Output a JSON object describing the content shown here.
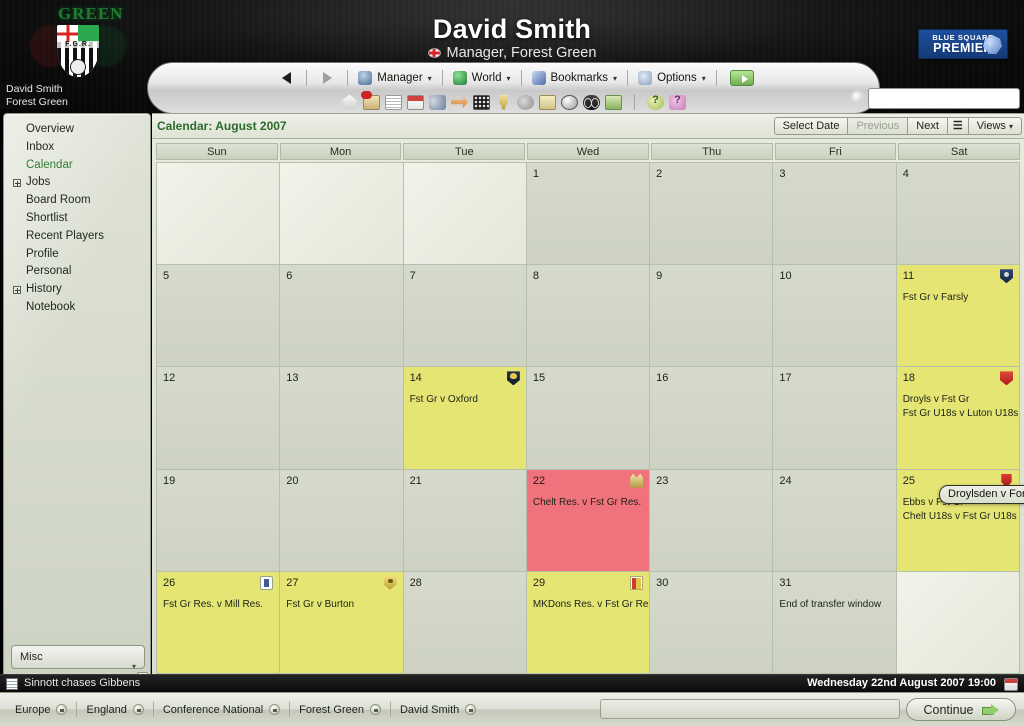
{
  "banner": {
    "title": "David Smith",
    "subtitle": "Manager, Forest Green",
    "user_name": "David Smith",
    "user_club": "Forest Green",
    "crest_text": "GREEN",
    "crest_letters": "F.G.R.",
    "league_logo_line1": "BLUE SQUARE",
    "league_logo_line2": "PREMIER"
  },
  "toolbar": {
    "back_icon": "back-arrow-icon",
    "forward_icon": "forward-arrow-icon",
    "menus": [
      {
        "label": "Manager",
        "icon": "manager-icon"
      },
      {
        "label": "World",
        "icon": "globe-icon"
      },
      {
        "label": "Bookmarks",
        "icon": "book-icon"
      },
      {
        "label": "Options",
        "icon": "options-icon"
      }
    ],
    "go_icon": "green-arrow-icon",
    "quick_icons": [
      "home-icon",
      "inbox-icon",
      "news-icon",
      "calendar-icon",
      "squad-icon",
      "transfers-icon",
      "tactics-icon",
      "competitions-icon",
      "training-icon",
      "board-icon",
      "fixtures-icon",
      "scouting-icon",
      "finances-icon",
      "help-icon",
      "hints-icon"
    ],
    "search_placeholder": "",
    "search_value": ""
  },
  "sidebar": {
    "items": [
      {
        "label": "Overview",
        "expandable": false,
        "selected": false
      },
      {
        "label": "Inbox",
        "expandable": false,
        "selected": false
      },
      {
        "label": "Calendar",
        "expandable": false,
        "selected": true
      },
      {
        "label": "Jobs",
        "expandable": true,
        "selected": false
      },
      {
        "label": "Board Room",
        "expandable": false,
        "selected": false
      },
      {
        "label": "Shortlist",
        "expandable": false,
        "selected": false
      },
      {
        "label": "Recent Players",
        "expandable": false,
        "selected": false
      },
      {
        "label": "Profile",
        "expandable": false,
        "selected": false
      },
      {
        "label": "Personal",
        "expandable": false,
        "selected": false
      },
      {
        "label": "History",
        "expandable": true,
        "selected": false
      },
      {
        "label": "Notebook",
        "expandable": false,
        "selected": false
      }
    ],
    "misc_label": "Misc"
  },
  "calendar": {
    "title": "Calendar: August 2007",
    "buttons": [
      {
        "label": "Select Date",
        "disabled": false
      },
      {
        "label": "Previous",
        "disabled": true
      },
      {
        "label": "Next",
        "disabled": false
      }
    ],
    "list_icon": "list-view-icon",
    "views_label": "Views",
    "day_headers": [
      "Sun",
      "Mon",
      "Tue",
      "Wed",
      "Thu",
      "Fri",
      "Sat"
    ],
    "weeks": [
      [
        {
          "day": "",
          "type": "empty",
          "events": [],
          "icon": null
        },
        {
          "day": "",
          "type": "empty",
          "events": [],
          "icon": null
        },
        {
          "day": "",
          "type": "empty",
          "events": [],
          "icon": null
        },
        {
          "day": "1",
          "type": "plain",
          "events": [],
          "icon": null
        },
        {
          "day": "2",
          "type": "plain",
          "events": [],
          "icon": null
        },
        {
          "day": "3",
          "type": "plain",
          "events": [],
          "icon": null
        },
        {
          "day": "4",
          "type": "plain",
          "events": [],
          "icon": null
        }
      ],
      [
        {
          "day": "5",
          "type": "plain",
          "events": [],
          "icon": null
        },
        {
          "day": "6",
          "type": "plain",
          "events": [],
          "icon": null
        },
        {
          "day": "7",
          "type": "plain",
          "events": [],
          "icon": null
        },
        {
          "day": "8",
          "type": "plain",
          "events": [],
          "icon": null
        },
        {
          "day": "9",
          "type": "plain",
          "events": [],
          "icon": null
        },
        {
          "day": "10",
          "type": "plain",
          "events": [],
          "icon": null
        },
        {
          "day": "11",
          "type": "match",
          "events": [
            "Fst Gr v Farsly"
          ],
          "icon": "club-crest-blue-icon"
        }
      ],
      [
        {
          "day": "12",
          "type": "plain",
          "events": [],
          "icon": null
        },
        {
          "day": "13",
          "type": "plain",
          "events": [],
          "icon": null
        },
        {
          "day": "14",
          "type": "match",
          "events": [
            "Fst Gr v Oxford"
          ],
          "icon": "club-crest-oxford-icon"
        },
        {
          "day": "15",
          "type": "plain",
          "events": [],
          "icon": null
        },
        {
          "day": "16",
          "type": "plain",
          "events": [],
          "icon": null
        },
        {
          "day": "17",
          "type": "plain",
          "events": [],
          "icon": null
        },
        {
          "day": "18",
          "type": "match",
          "events": [
            "Droyls v Fst Gr",
            "Fst Gr U18s v Luton U18s"
          ],
          "icon": "club-crest-red-icon"
        }
      ],
      [
        {
          "day": "19",
          "type": "plain",
          "events": [],
          "icon": null
        },
        {
          "day": "20",
          "type": "plain",
          "events": [],
          "icon": null
        },
        {
          "day": "21",
          "type": "plain",
          "events": [],
          "icon": null
        },
        {
          "day": "22",
          "type": "today",
          "events": [
            "Chelt Res. v Fst Gr Res."
          ],
          "icon": "club-crest-crown-icon"
        },
        {
          "day": "23",
          "type": "plain",
          "events": [],
          "icon": null
        },
        {
          "day": "24",
          "type": "plain",
          "events": [],
          "icon": null
        },
        {
          "day": "25",
          "type": "match",
          "events": [
            "Ebbs v Fst Gr",
            "Chelt U18s v Fst Gr U18s"
          ],
          "icon": "club-crest-redshield-icon"
        }
      ],
      [
        {
          "day": "26",
          "type": "match",
          "events": [
            "Fst Gr Res. v Mill Res."
          ],
          "icon": "club-crest-white-icon"
        },
        {
          "day": "27",
          "type": "match",
          "events": [
            "Fst Gr v Burton"
          ],
          "icon": "club-crest-yellow-icon"
        },
        {
          "day": "28",
          "type": "plain",
          "events": [],
          "icon": null
        },
        {
          "day": "29",
          "type": "match",
          "events": [
            "MKDons Res. v Fst Gr Res."
          ],
          "icon": "club-crest-mixed-icon"
        },
        {
          "day": "30",
          "type": "plain",
          "events": [],
          "icon": null
        },
        {
          "day": "31",
          "type": "plain",
          "events": [
            "End of transfer window"
          ],
          "icon": null
        },
        {
          "day": "",
          "type": "empty",
          "events": [],
          "icon": null
        }
      ]
    ],
    "tooltip": "Droylsden v Forest Green (Conference National)"
  },
  "footer": {
    "news_headline": "Sinnott chases Gibbens",
    "date_text": "Wednesday 22nd August 2007 19:00",
    "breadcrumbs": [
      "Europe",
      "England",
      "Conference National",
      "Forest Green",
      "David Smith"
    ],
    "continue_label": "Continue"
  },
  "colors": {
    "match_day": "#e5e573",
    "today": "#f0727c",
    "selected_nav": "#2e7d35",
    "title_green": "#2b6b2e"
  }
}
